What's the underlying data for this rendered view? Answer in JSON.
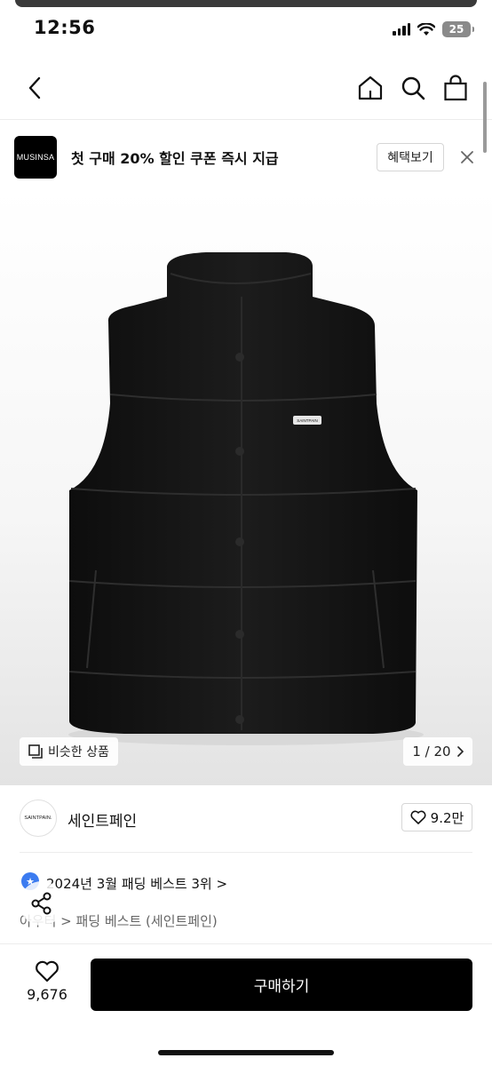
{
  "status_bar": {
    "time": "12:56",
    "battery": "25",
    "icons": [
      "signal-icon",
      "wifi-icon",
      "battery-icon"
    ]
  },
  "nav": {
    "icons": [
      "back-arrow-icon",
      "home-icon",
      "search-icon",
      "shopping-bag-icon"
    ]
  },
  "promo": {
    "logo_text": "MUSINSA",
    "message": "첫 구매 20% 할인 쿠폰 즉시 지급",
    "button_label": "혜택보기",
    "close_icon": "close-icon"
  },
  "product_image": {
    "similar_label": "비슷한 상품",
    "similar_icon": "similar-items-icon",
    "counter": "1 / 20",
    "label_on_vest": "SAINTPAIN"
  },
  "brand": {
    "logo_text": "SAINTPAIN.",
    "name": "세인트페인",
    "likes": "9.2만"
  },
  "ranking": {
    "text": "2024년 3월 패딩 베스트 3위 >",
    "category": "아우터 > 패딩 베스트 (세인트페인)"
  },
  "bottom_bar": {
    "like_count": "9,676",
    "buy_label": "구매하기"
  },
  "colors": {
    "primary": "#000000",
    "rank_badge": "#3b7bf0",
    "border": "#d6d6d6"
  }
}
